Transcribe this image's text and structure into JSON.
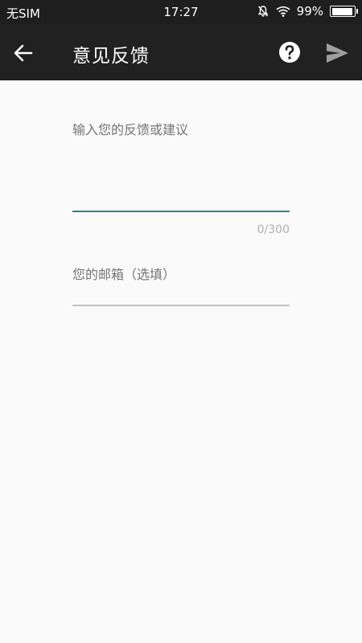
{
  "status_bar": {
    "carrier": "无SIM",
    "time": "17:27",
    "battery_text": "99%",
    "battery_level": 0.99,
    "icons": [
      "mute-bell-icon",
      "wifi-icon",
      "battery-icon"
    ]
  },
  "app_bar": {
    "title": "意见反馈",
    "icons": [
      "back-arrow-icon",
      "help-icon",
      "send-icon"
    ]
  },
  "form": {
    "feedback_placeholder": "输入您的反馈或建议",
    "counter": "0/300",
    "email_placeholder": "您的邮箱（选填）"
  },
  "colors": {
    "toolbar": "#212121",
    "status_bar": "#1e1e1e",
    "accent": "#26877e",
    "background": "#fafafa",
    "underline_inactive": "#c2c2c2",
    "send_icon_disabled": "#9e9e9e"
  }
}
